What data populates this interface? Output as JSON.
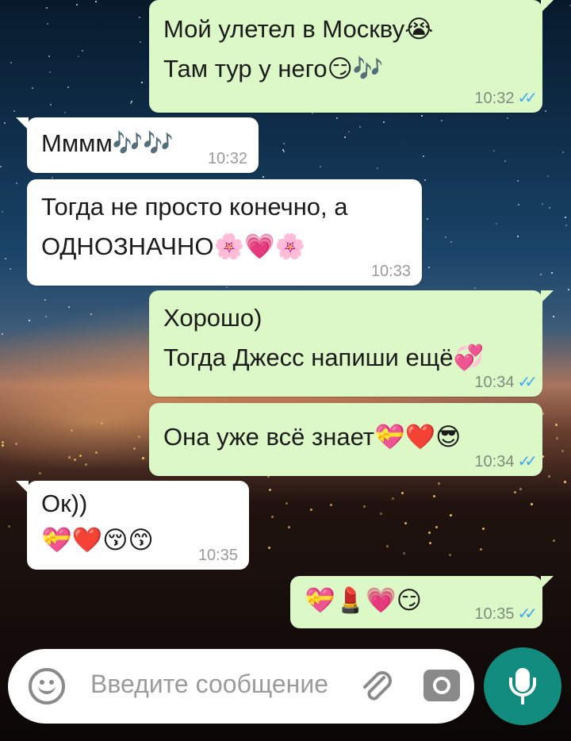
{
  "messages": [
    {
      "dir": "out",
      "lines": [
        "Мой улетел в Москву😭",
        "Там тур у него😏🎶"
      ],
      "time": "10:32",
      "ticks": "✓✓"
    },
    {
      "dir": "in",
      "lines": [
        "Мммм🎶🎶"
      ],
      "time": "10:32"
    },
    {
      "dir": "in",
      "lines": [
        "Тогда не просто конечно, а",
        "ОДНОЗНАЧНО🌸💗🌸"
      ],
      "time": "10:33"
    },
    {
      "dir": "out",
      "lines": [
        "Хорошо)",
        "Тогда Джесс напиши ещё💞"
      ],
      "time": "10:34",
      "ticks": "✓✓"
    },
    {
      "dir": "out",
      "lines": [
        "Она уже всё знает💝❤️😎"
      ],
      "time": "10:34",
      "ticks": "✓✓"
    },
    {
      "dir": "in",
      "lines": [
        "Ок))",
        "💝❤️😚😙"
      ],
      "time": "10:35"
    },
    {
      "dir": "out",
      "lines": [
        "💝💄💗😏"
      ],
      "time": "10:35",
      "ticks": "✓✓"
    }
  ],
  "composer": {
    "placeholder": "Введите сообщение",
    "emoji_icon": "emoji-icon",
    "attach_icon": "paperclip-icon",
    "camera_icon": "camera-icon",
    "mic_icon": "microphone-icon"
  },
  "colors": {
    "outgoing_bubble": "#dcf8c6",
    "incoming_bubble": "#ffffff",
    "read_ticks": "#3fa9f5",
    "mic_button": "#128c7e"
  }
}
